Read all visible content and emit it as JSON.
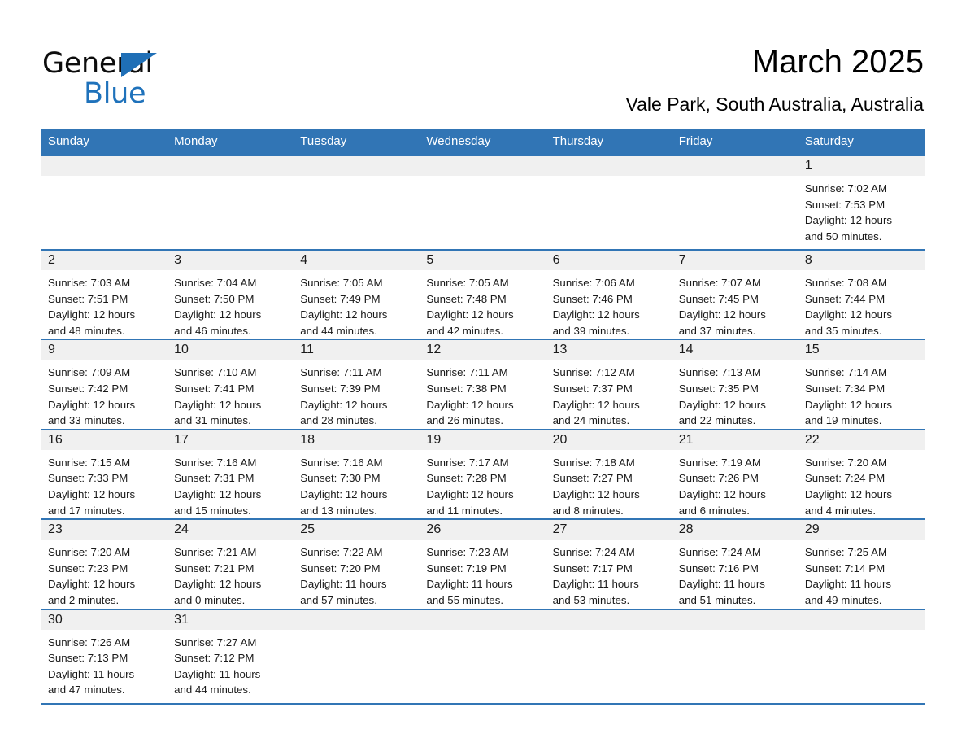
{
  "brand": {
    "word_one": "General",
    "word_two": "Blue",
    "triangle_color": "#1f6fb6",
    "blue_text_color": "#1f72bb"
  },
  "header": {
    "title": "March 2025",
    "subtitle": "Vale Park, South Australia, Australia",
    "accent_color": "#3175b5",
    "daynum_band_color": "#f0f0f0"
  },
  "calendar": {
    "weekday_headers": [
      "Sunday",
      "Monday",
      "Tuesday",
      "Wednesday",
      "Thursday",
      "Friday",
      "Saturday"
    ],
    "weeks": [
      [
        {
          "day": "",
          "sunrise": "",
          "sunset": "",
          "daylight_1": "",
          "daylight_2": ""
        },
        {
          "day": "",
          "sunrise": "",
          "sunset": "",
          "daylight_1": "",
          "daylight_2": ""
        },
        {
          "day": "",
          "sunrise": "",
          "sunset": "",
          "daylight_1": "",
          "daylight_2": ""
        },
        {
          "day": "",
          "sunrise": "",
          "sunset": "",
          "daylight_1": "",
          "daylight_2": ""
        },
        {
          "day": "",
          "sunrise": "",
          "sunset": "",
          "daylight_1": "",
          "daylight_2": ""
        },
        {
          "day": "",
          "sunrise": "",
          "sunset": "",
          "daylight_1": "",
          "daylight_2": ""
        },
        {
          "day": "1",
          "sunrise": "Sunrise: 7:02 AM",
          "sunset": "Sunset: 7:53 PM",
          "daylight_1": "Daylight: 12 hours",
          "daylight_2": "and 50 minutes."
        }
      ],
      [
        {
          "day": "2",
          "sunrise": "Sunrise: 7:03 AM",
          "sunset": "Sunset: 7:51 PM",
          "daylight_1": "Daylight: 12 hours",
          "daylight_2": "and 48 minutes."
        },
        {
          "day": "3",
          "sunrise": "Sunrise: 7:04 AM",
          "sunset": "Sunset: 7:50 PM",
          "daylight_1": "Daylight: 12 hours",
          "daylight_2": "and 46 minutes."
        },
        {
          "day": "4",
          "sunrise": "Sunrise: 7:05 AM",
          "sunset": "Sunset: 7:49 PM",
          "daylight_1": "Daylight: 12 hours",
          "daylight_2": "and 44 minutes."
        },
        {
          "day": "5",
          "sunrise": "Sunrise: 7:05 AM",
          "sunset": "Sunset: 7:48 PM",
          "daylight_1": "Daylight: 12 hours",
          "daylight_2": "and 42 minutes."
        },
        {
          "day": "6",
          "sunrise": "Sunrise: 7:06 AM",
          "sunset": "Sunset: 7:46 PM",
          "daylight_1": "Daylight: 12 hours",
          "daylight_2": "and 39 minutes."
        },
        {
          "day": "7",
          "sunrise": "Sunrise: 7:07 AM",
          "sunset": "Sunset: 7:45 PM",
          "daylight_1": "Daylight: 12 hours",
          "daylight_2": "and 37 minutes."
        },
        {
          "day": "8",
          "sunrise": "Sunrise: 7:08 AM",
          "sunset": "Sunset: 7:44 PM",
          "daylight_1": "Daylight: 12 hours",
          "daylight_2": "and 35 minutes."
        }
      ],
      [
        {
          "day": "9",
          "sunrise": "Sunrise: 7:09 AM",
          "sunset": "Sunset: 7:42 PM",
          "daylight_1": "Daylight: 12 hours",
          "daylight_2": "and 33 minutes."
        },
        {
          "day": "10",
          "sunrise": "Sunrise: 7:10 AM",
          "sunset": "Sunset: 7:41 PM",
          "daylight_1": "Daylight: 12 hours",
          "daylight_2": "and 31 minutes."
        },
        {
          "day": "11",
          "sunrise": "Sunrise: 7:11 AM",
          "sunset": "Sunset: 7:39 PM",
          "daylight_1": "Daylight: 12 hours",
          "daylight_2": "and 28 minutes."
        },
        {
          "day": "12",
          "sunrise": "Sunrise: 7:11 AM",
          "sunset": "Sunset: 7:38 PM",
          "daylight_1": "Daylight: 12 hours",
          "daylight_2": "and 26 minutes."
        },
        {
          "day": "13",
          "sunrise": "Sunrise: 7:12 AM",
          "sunset": "Sunset: 7:37 PM",
          "daylight_1": "Daylight: 12 hours",
          "daylight_2": "and 24 minutes."
        },
        {
          "day": "14",
          "sunrise": "Sunrise: 7:13 AM",
          "sunset": "Sunset: 7:35 PM",
          "daylight_1": "Daylight: 12 hours",
          "daylight_2": "and 22 minutes."
        },
        {
          "day": "15",
          "sunrise": "Sunrise: 7:14 AM",
          "sunset": "Sunset: 7:34 PM",
          "daylight_1": "Daylight: 12 hours",
          "daylight_2": "and 19 minutes."
        }
      ],
      [
        {
          "day": "16",
          "sunrise": "Sunrise: 7:15 AM",
          "sunset": "Sunset: 7:33 PM",
          "daylight_1": "Daylight: 12 hours",
          "daylight_2": "and 17 minutes."
        },
        {
          "day": "17",
          "sunrise": "Sunrise: 7:16 AM",
          "sunset": "Sunset: 7:31 PM",
          "daylight_1": "Daylight: 12 hours",
          "daylight_2": "and 15 minutes."
        },
        {
          "day": "18",
          "sunrise": "Sunrise: 7:16 AM",
          "sunset": "Sunset: 7:30 PM",
          "daylight_1": "Daylight: 12 hours",
          "daylight_2": "and 13 minutes."
        },
        {
          "day": "19",
          "sunrise": "Sunrise: 7:17 AM",
          "sunset": "Sunset: 7:28 PM",
          "daylight_1": "Daylight: 12 hours",
          "daylight_2": "and 11 minutes."
        },
        {
          "day": "20",
          "sunrise": "Sunrise: 7:18 AM",
          "sunset": "Sunset: 7:27 PM",
          "daylight_1": "Daylight: 12 hours",
          "daylight_2": "and 8 minutes."
        },
        {
          "day": "21",
          "sunrise": "Sunrise: 7:19 AM",
          "sunset": "Sunset: 7:26 PM",
          "daylight_1": "Daylight: 12 hours",
          "daylight_2": "and 6 minutes."
        },
        {
          "day": "22",
          "sunrise": "Sunrise: 7:20 AM",
          "sunset": "Sunset: 7:24 PM",
          "daylight_1": "Daylight: 12 hours",
          "daylight_2": "and 4 minutes."
        }
      ],
      [
        {
          "day": "23",
          "sunrise": "Sunrise: 7:20 AM",
          "sunset": "Sunset: 7:23 PM",
          "daylight_1": "Daylight: 12 hours",
          "daylight_2": "and 2 minutes."
        },
        {
          "day": "24",
          "sunrise": "Sunrise: 7:21 AM",
          "sunset": "Sunset: 7:21 PM",
          "daylight_1": "Daylight: 12 hours",
          "daylight_2": "and 0 minutes."
        },
        {
          "day": "25",
          "sunrise": "Sunrise: 7:22 AM",
          "sunset": "Sunset: 7:20 PM",
          "daylight_1": "Daylight: 11 hours",
          "daylight_2": "and 57 minutes."
        },
        {
          "day": "26",
          "sunrise": "Sunrise: 7:23 AM",
          "sunset": "Sunset: 7:19 PM",
          "daylight_1": "Daylight: 11 hours",
          "daylight_2": "and 55 minutes."
        },
        {
          "day": "27",
          "sunrise": "Sunrise: 7:24 AM",
          "sunset": "Sunset: 7:17 PM",
          "daylight_1": "Daylight: 11 hours",
          "daylight_2": "and 53 minutes."
        },
        {
          "day": "28",
          "sunrise": "Sunrise: 7:24 AM",
          "sunset": "Sunset: 7:16 PM",
          "daylight_1": "Daylight: 11 hours",
          "daylight_2": "and 51 minutes."
        },
        {
          "day": "29",
          "sunrise": "Sunrise: 7:25 AM",
          "sunset": "Sunset: 7:14 PM",
          "daylight_1": "Daylight: 11 hours",
          "daylight_2": "and 49 minutes."
        }
      ],
      [
        {
          "day": "30",
          "sunrise": "Sunrise: 7:26 AM",
          "sunset": "Sunset: 7:13 PM",
          "daylight_1": "Daylight: 11 hours",
          "daylight_2": "and 47 minutes."
        },
        {
          "day": "31",
          "sunrise": "Sunrise: 7:27 AM",
          "sunset": "Sunset: 7:12 PM",
          "daylight_1": "Daylight: 11 hours",
          "daylight_2": "and 44 minutes."
        },
        {
          "day": "",
          "sunrise": "",
          "sunset": "",
          "daylight_1": "",
          "daylight_2": ""
        },
        {
          "day": "",
          "sunrise": "",
          "sunset": "",
          "daylight_1": "",
          "daylight_2": ""
        },
        {
          "day": "",
          "sunrise": "",
          "sunset": "",
          "daylight_1": "",
          "daylight_2": ""
        },
        {
          "day": "",
          "sunrise": "",
          "sunset": "",
          "daylight_1": "",
          "daylight_2": ""
        },
        {
          "day": "",
          "sunrise": "",
          "sunset": "",
          "daylight_1": "",
          "daylight_2": ""
        }
      ]
    ]
  }
}
